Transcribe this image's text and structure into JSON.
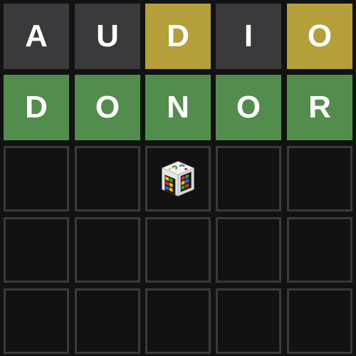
{
  "board": {
    "rows": [
      {
        "tiles": [
          {
            "letter": "A",
            "state": "absent"
          },
          {
            "letter": "U",
            "state": "absent"
          },
          {
            "letter": "D",
            "state": "present"
          },
          {
            "letter": "I",
            "state": "absent"
          },
          {
            "letter": "O",
            "state": "present"
          }
        ]
      },
      {
        "tiles": [
          {
            "letter": "D",
            "state": "correct"
          },
          {
            "letter": "O",
            "state": "correct"
          },
          {
            "letter": "N",
            "state": "correct"
          },
          {
            "letter": "O",
            "state": "correct"
          },
          {
            "letter": "R",
            "state": "correct"
          }
        ]
      }
    ],
    "empty_row_count": 3,
    "random_icon": "dice-icon"
  },
  "colors": {
    "absent": "#3a3a3c",
    "present": "#b59f3b",
    "correct": "#538d4e",
    "empty_border": "#3a3a3c",
    "background": "#121213"
  }
}
